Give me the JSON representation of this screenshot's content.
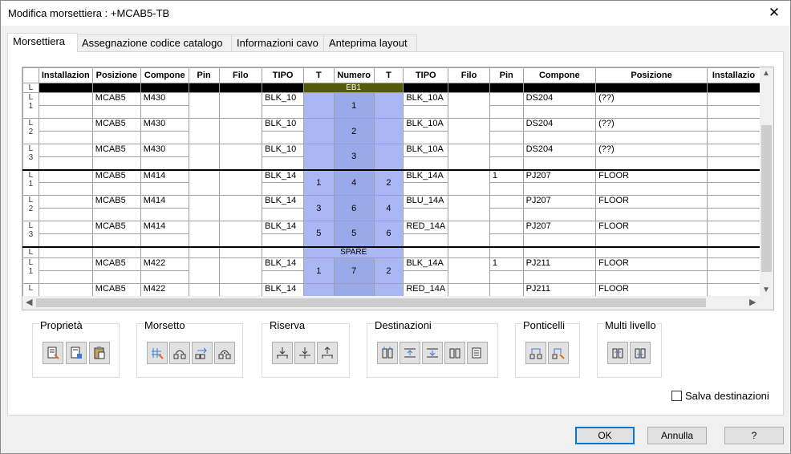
{
  "window": {
    "title": "Modifica morsettiera : +MCAB5-TB",
    "close_glyph": "✕"
  },
  "tabs": [
    "Morsettiera",
    "Assegnazione codice catalogo",
    "Informazioni cavo",
    "Anteprima layout"
  ],
  "grid": {
    "headers": [
      "",
      "Installazion",
      "Posizione",
      "Compone",
      "Pin",
      "Filo",
      "TIPO",
      "T",
      "Numero",
      "T",
      "TIPO",
      "Filo",
      "Pin",
      "Compone",
      "Posizione",
      "Installazio"
    ],
    "sep_labels": {
      "eb1": "EB1",
      "spare": "SPARE"
    },
    "row_header_letter": "L",
    "rows": [
      {
        "n": "1",
        "pos": "MCAB5",
        "comp": "M430",
        "tipo": "BLK_10",
        "tl": "",
        "num": "1",
        "tr": "",
        "tipo2": "BLK_10A",
        "pin2": "",
        "comp2": "DS204",
        "pos2": "(??)"
      },
      {
        "n": "2",
        "pos": "MCAB5",
        "comp": "M430",
        "tipo": "BLK_10",
        "tl": "",
        "num": "2",
        "tr": "",
        "tipo2": "BLK_10A",
        "pin2": "",
        "comp2": "DS204",
        "pos2": "(??)"
      },
      {
        "n": "3",
        "pos": "MCAB5",
        "comp": "M430",
        "tipo": "BLK_10",
        "tl": "",
        "num": "3",
        "tr": "",
        "tipo2": "BLK_10A",
        "pin2": "",
        "comp2": "DS204",
        "pos2": "(??)"
      },
      {
        "n": "1",
        "pos": "MCAB5",
        "comp": "M414",
        "tipo": "BLK_14",
        "tl": "1",
        "num": "4",
        "tr": "2",
        "tipo2": "BLK_14A",
        "pin2": "1",
        "comp2": "PJ207",
        "pos2": "FLOOR"
      },
      {
        "n": "2",
        "pos": "MCAB5",
        "comp": "M414",
        "tipo": "BLK_14",
        "tl": "3",
        "num": "6",
        "tr": "4",
        "tipo2": "BLU_14A",
        "pin2": "",
        "comp2": "PJ207",
        "pos2": "FLOOR"
      },
      {
        "n": "3",
        "pos": "MCAB5",
        "comp": "M414",
        "tipo": "BLK_14",
        "tl": "5",
        "num": "5",
        "tr": "6",
        "tipo2": "RED_14A",
        "pin2": "",
        "comp2": "PJ207",
        "pos2": "FLOOR"
      },
      {
        "n": "1",
        "pos": "MCAB5",
        "comp": "M422",
        "tipo": "BLK_14",
        "tl": "1",
        "num": "7",
        "tr": "2",
        "tipo2": "BLK_14A",
        "pin2": "1",
        "comp2": "PJ211",
        "pos2": "FLOOR"
      },
      {
        "n": "",
        "pos": "MCAB5",
        "comp": "M422",
        "tipo": "BLK_14",
        "tl": "",
        "num": "",
        "tr": "",
        "tipo2": "RED_14A",
        "pin2": "",
        "comp2": "PJ211",
        "pos2": "FLOOR"
      }
    ]
  },
  "groups": {
    "proprieta": "Proprietà",
    "morsetto": "Morsetto",
    "riserva": "Riserva",
    "destinazioni": "Destinazioni",
    "ponticelli": "Ponticelli",
    "multi": "Multi livello"
  },
  "checkbox": {
    "label": "Salva destinazioni",
    "checked": false
  },
  "buttons": {
    "ok": "OK",
    "cancel": "Annulla",
    "help": "?"
  },
  "colors": {
    "terminal_blue": "#a9b7f5",
    "eb1_bar": "#55590a",
    "accent": "#0078d7"
  }
}
